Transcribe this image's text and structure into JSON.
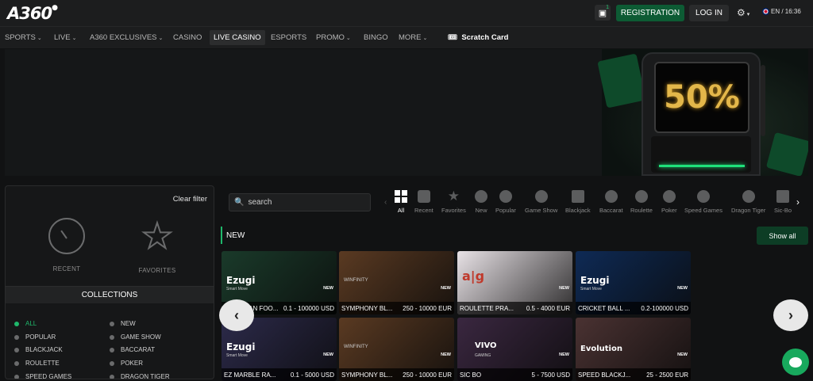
{
  "header": {
    "logo": "A360",
    "gift_count": "1",
    "registration_label": "REGISTRATION",
    "login_label": "LOG IN",
    "language": "EN / 16:36"
  },
  "nav": {
    "items": [
      {
        "label": "SPORTS",
        "dropdown": true
      },
      {
        "label": "LIVE",
        "dropdown": true
      },
      {
        "label": "A360 EXCLUSIVES",
        "dropdown": true
      },
      {
        "label": "CASINO",
        "dropdown": false
      },
      {
        "label": "LIVE CASINO",
        "dropdown": false,
        "active": true
      },
      {
        "label": "ESPORTS",
        "dropdown": false
      },
      {
        "label": "PROMO",
        "dropdown": true
      },
      {
        "label": "BINGO",
        "dropdown": false
      },
      {
        "label": "MORE",
        "dropdown": true
      }
    ],
    "scratch_card": "Scratch Card"
  },
  "banner": {
    "promo_text": "50%"
  },
  "filter": {
    "clear_label": "Clear filter",
    "recent_label": "RECENT",
    "favorites_label": "FAVORITES",
    "collections_title": "COLLECTIONS",
    "collections": [
      {
        "label": "ALL",
        "active": true
      },
      {
        "label": "NEW",
        "active": false
      },
      {
        "label": "POPULAR",
        "active": false
      },
      {
        "label": "GAME SHOW",
        "active": false
      },
      {
        "label": "BLACKJACK",
        "active": false
      },
      {
        "label": "BACCARAT",
        "active": false
      },
      {
        "label": "ROULETTE",
        "active": false
      },
      {
        "label": "POKER",
        "active": false
      },
      {
        "label": "SPEED GAMES",
        "active": false
      },
      {
        "label": "DRAGON TIGER",
        "active": false
      }
    ]
  },
  "search": {
    "placeholder": "search"
  },
  "categories": [
    {
      "label": "All",
      "icon": "grid-icon",
      "active": true
    },
    {
      "label": "Recent",
      "icon": "recent-icon"
    },
    {
      "label": "Favorites",
      "icon": "star-icon"
    },
    {
      "label": "New",
      "icon": "new-badge-icon"
    },
    {
      "label": "Popular",
      "icon": "fire-icon"
    },
    {
      "label": "Game Show",
      "icon": "microphone-icon"
    },
    {
      "label": "Blackjack",
      "icon": "card-icon"
    },
    {
      "label": "Baccarat",
      "icon": "baccarat-icon"
    },
    {
      "label": "Roulette",
      "icon": "roulette-icon"
    },
    {
      "label": "Poker",
      "icon": "poker-chip-icon"
    },
    {
      "label": "Speed Games",
      "icon": "speedometer-icon"
    },
    {
      "label": "Dragon Tiger",
      "icon": "dragon-icon"
    },
    {
      "label": "Sic-Bo",
      "icon": "dice-icon"
    }
  ],
  "section": {
    "title": "NEW",
    "show_all_label": "Show all"
  },
  "games": [
    {
      "name": "AMERICAN FOO...",
      "limits": "0.1 - 100000 USD",
      "provider": "Ezugi",
      "provider_sub": "Smart Move",
      "new": "NEW",
      "bg": "#1a3a2a"
    },
    {
      "name": "SYMPHONY BL...",
      "limits": "250 - 10000 EUR",
      "provider": "",
      "provider_sub": "WINFINITY",
      "new": "NEW",
      "bg": "#5a3a22"
    },
    {
      "name": "ROULETTE PRA...",
      "limits": "0.5 - 4000 EUR",
      "provider": "a|g",
      "provider_sub": "",
      "new": "NEW",
      "bg": "#e8e2e6"
    },
    {
      "name": "CRICKET BALL ...",
      "limits": "0.2-100000 USD",
      "provider": "Ezugi",
      "provider_sub": "Smart Move",
      "new": "NEW",
      "bg": "#0e2a55"
    },
    {
      "name": "EZ MARBLE RA...",
      "limits": "0.1 - 5000 USD",
      "provider": "Ezugi",
      "provider_sub": "Smart Move",
      "new": "NEW",
      "bg": "#2c2a4a"
    },
    {
      "name": "SYMPHONY BL...",
      "limits": "250 - 10000 EUR",
      "provider": "",
      "provider_sub": "WINFINITY",
      "new": "NEW",
      "bg": "#5a3a22"
    },
    {
      "name": "SIC BO",
      "limits": "5 - 7500 USD",
      "provider": "VIVO",
      "provider_sub": "GAMING",
      "new": "NEW",
      "bg": "#3a2740"
    },
    {
      "name": "SPEED BLACKJ...",
      "limits": "25 - 2500 EUR",
      "provider": "Evolution",
      "provider_sub": "",
      "new": "NEW",
      "bg": "#4a3232"
    }
  ]
}
